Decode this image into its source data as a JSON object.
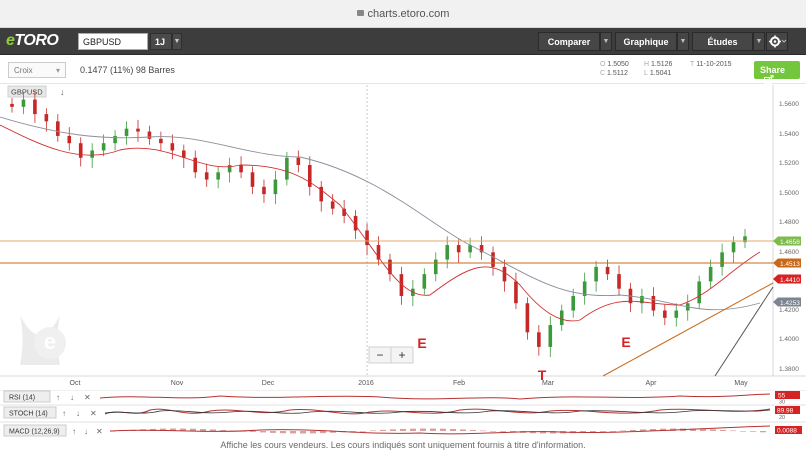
{
  "browser": {
    "url": "charts.etoro.com"
  },
  "header": {
    "logo": "etoro",
    "symbol": "GBPUSD",
    "timeframe": "1J",
    "compare_label": "Comparer",
    "graph_label": "Graphique",
    "studies_label": "Études"
  },
  "toolbar": {
    "crosshair_label": "Croix",
    "bars_info": "0.1477 (11%) 98 Barres",
    "ohlc": {
      "open": "1.5050",
      "close": "1.5112",
      "high": "1.5126",
      "low": "1.5041",
      "date": "11-10-2015"
    },
    "ohlc_keys": {
      "open": "O",
      "close": "C",
      "high": "H",
      "low": "L",
      "date": "T"
    },
    "share_label": "Share"
  },
  "chart": {
    "symbol_tag": "GBPUSD",
    "x_ticks": [
      "Oct",
      "Nov",
      "Dec",
      "2016",
      "Feb",
      "Mar",
      "Apr",
      "May"
    ],
    "y_ticks": [
      "1.5600",
      "1.5400",
      "1.5200",
      "1.5000",
      "1.4800",
      "1.4600",
      "1.4400",
      "1.4200",
      "1.4000",
      "1.3800"
    ],
    "price_labels": [
      {
        "value": "1.4658",
        "color": "#7dbb4a"
      },
      {
        "value": "1.4513",
        "color": "#c8691a"
      },
      {
        "value": "1.4410",
        "color": "#d62222"
      },
      {
        "value": "1.4253",
        "color": "#7c8490"
      }
    ],
    "annotations": [
      "E",
      "T",
      "E"
    ],
    "zoom_out": "−",
    "zoom_in": "+",
    "horizontal_levels": [
      1.4658,
      1.4513
    ],
    "candles": [
      1.555,
      1.56,
      1.55,
      1.545,
      1.535,
      1.53,
      1.52,
      1.525,
      1.53,
      1.535,
      1.54,
      1.538,
      1.533,
      1.53,
      1.525,
      1.52,
      1.51,
      1.505,
      1.51,
      1.515,
      1.51,
      1.5,
      1.495,
      1.505,
      1.52,
      1.515,
      1.5,
      1.49,
      1.485,
      1.48,
      1.47,
      1.46,
      1.45,
      1.44,
      1.425,
      1.43,
      1.44,
      1.45,
      1.46,
      1.455,
      1.46,
      1.455,
      1.445,
      1.435,
      1.42,
      1.4,
      1.39,
      1.405,
      1.415,
      1.425,
      1.435,
      1.445,
      1.44,
      1.43,
      1.42,
      1.425,
      1.415,
      1.41,
      1.415,
      1.42,
      1.435,
      1.445,
      1.455,
      1.462,
      1.466
    ]
  },
  "indicators": [
    {
      "label": "RSI (14)",
      "value": "55",
      "value_alt": "30"
    },
    {
      "label": "STOCH (14)",
      "value": "89.98",
      "value_alt": "20"
    },
    {
      "label": "MACD (12,26,9)",
      "value": "0.0088",
      "value_alt": ""
    }
  ],
  "footer": {
    "disclaimer": "Affiche les cours vendeurs. Les cours indiqués sont uniquement fournis à titre d'information."
  }
}
